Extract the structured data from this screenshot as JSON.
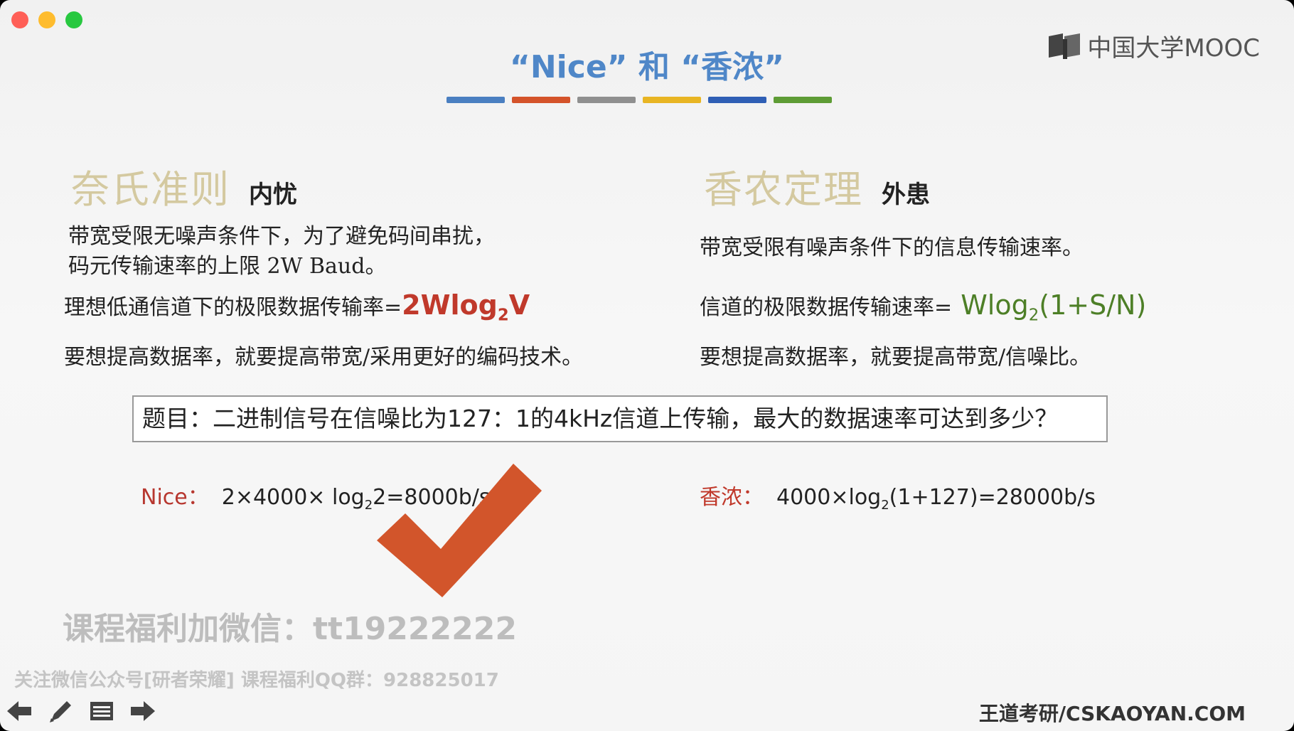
{
  "slide": {
    "title": "“Nice” 和 “香浓”",
    "logo_text": "中国大学MOOC",
    "title_bar_colors": [
      "#4a7fc1",
      "#d4532a",
      "#8f8f8f",
      "#e8b523",
      "#2f5fb5",
      "#5e9c35"
    ]
  },
  "left": {
    "heading": "奈氏准则",
    "subheading": "内忧",
    "desc_line1": "带宽受限无噪声条件下，为了避免码间串扰，",
    "desc_line2": "码元传输速率的上限 2W Baud。",
    "rate_label": "理想低通信道下的极限数据传输率=",
    "rate_formula_a": "2Wlog",
    "rate_formula_sub": "2",
    "rate_formula_b": "V",
    "improve": "要想提高数据率，就要提高带宽/采用更好的编码技术。"
  },
  "right": {
    "heading": "香农定理",
    "subheading": "外患",
    "desc": "带宽受限有噪声条件下的信息传输速率。",
    "rate_label": "信道的极限数据传输速率=",
    "rate_formula_a": " Wlog",
    "rate_formula_sub": "2",
    "rate_formula_b": "(1+S/N)",
    "improve": "要想提高数据率，就要提高带宽/信噪比。"
  },
  "question": "题目：二进制信号在信噪比为127：1的4kHz信道上传输，最大的数据速率可达到多少？",
  "answers": {
    "nice_label": "Nice：",
    "nice_a": "2×4000× log",
    "nice_sub": "2",
    "nice_b": "2=8000b/s",
    "shannon_label": "香浓：",
    "shannon_a": "4000×log",
    "shannon_sub": "2",
    "shannon_b": "(1+127)=28000b/s"
  },
  "watermark": {
    "line1": "课程福利加微信：tt19222222",
    "line2": "关注微信公众号[研者荣耀] 课程福利QQ群：928825017"
  },
  "footer": "王道考研/CSKAOYAN.COM",
  "icons": {
    "check": "check-mark-icon",
    "back": "arrow-left-icon",
    "pen": "pencil-icon",
    "menu": "slide-menu-icon",
    "next": "arrow-right-icon"
  },
  "colors": {
    "title_blue": "#4f87c8",
    "formula_red": "#c0392b",
    "formula_green": "#4d7f27",
    "check_orange": "#d2552b"
  }
}
